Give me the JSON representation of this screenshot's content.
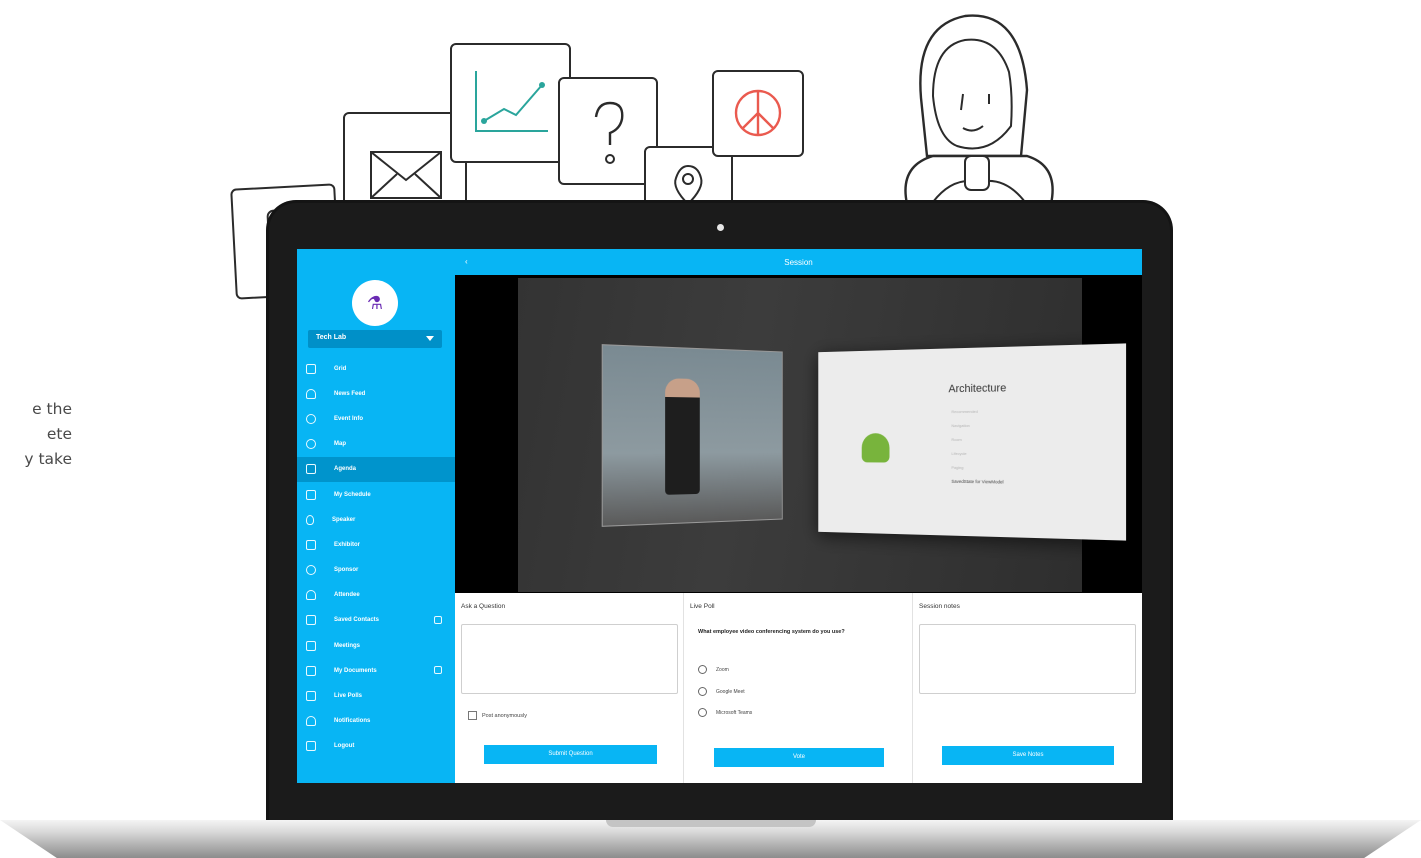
{
  "intro_cutoff": [
    "e the",
    "ete",
    "y take"
  ],
  "session_app": {
    "top_bar": {
      "back_icon": "chevron-left-icon",
      "back_glyph": "‹",
      "title": "Session"
    },
    "sidebar": {
      "logo_icon": "flask-icon",
      "event_selector": "Tech Lab",
      "items": [
        {
          "label": "Grid",
          "icon": "grid-icon",
          "active": false
        },
        {
          "label": "News Feed",
          "icon": "bell-icon",
          "active": false
        },
        {
          "label": "Event Info",
          "icon": "info-icon",
          "active": false
        },
        {
          "label": "Map",
          "icon": "map-icon",
          "active": false
        },
        {
          "label": "Agenda",
          "icon": "calendar-icon",
          "active": true
        },
        {
          "label": "My Schedule",
          "icon": "schedule-icon",
          "active": false
        },
        {
          "label": "Speaker",
          "icon": "microphone-icon",
          "active": false
        },
        {
          "label": "Exhibitor",
          "icon": "exhibitor-icon",
          "active": false
        },
        {
          "label": "Sponsor",
          "icon": "star-icon",
          "active": false
        },
        {
          "label": "Attendee",
          "icon": "person-icon",
          "active": false
        },
        {
          "label": "Saved Contacts",
          "icon": "contacts-icon",
          "active": false,
          "badge": true
        },
        {
          "label": "Meetings",
          "icon": "meetings-icon",
          "active": false
        },
        {
          "label": "My Documents",
          "icon": "documents-icon",
          "active": false,
          "badge": true
        },
        {
          "label": "Live Polls",
          "icon": "poll-icon",
          "active": false
        },
        {
          "label": "Notifications",
          "icon": "bell-icon",
          "active": false
        },
        {
          "label": "Logout",
          "icon": "logout-icon",
          "active": false
        }
      ]
    },
    "video": {
      "slide_title": "Architecture",
      "slide_items": [
        "Recommended",
        "Navigation",
        "Room",
        "Lifecycle",
        "Paging"
      ],
      "slide_highlight": "SavedState for ViewModel"
    },
    "ask_question": {
      "title": "Ask a Question",
      "checkbox_label": "Post anonymously",
      "button": "Submit Question"
    },
    "live_poll": {
      "title": "Live Poll",
      "question": "What employee video conferencing system do you use?",
      "options": [
        "Zoom",
        "Google Meet",
        "Microsoft Teams"
      ],
      "button": "Vote"
    },
    "session_notes": {
      "title": "Session notes",
      "button": "Save Notes"
    }
  },
  "doodles": [
    "phone-card-icon",
    "envelope-icon",
    "line-chart-icon",
    "question-mark-icon",
    "location-pin-icon",
    "peace-sign-icon",
    "woman-illustration"
  ]
}
